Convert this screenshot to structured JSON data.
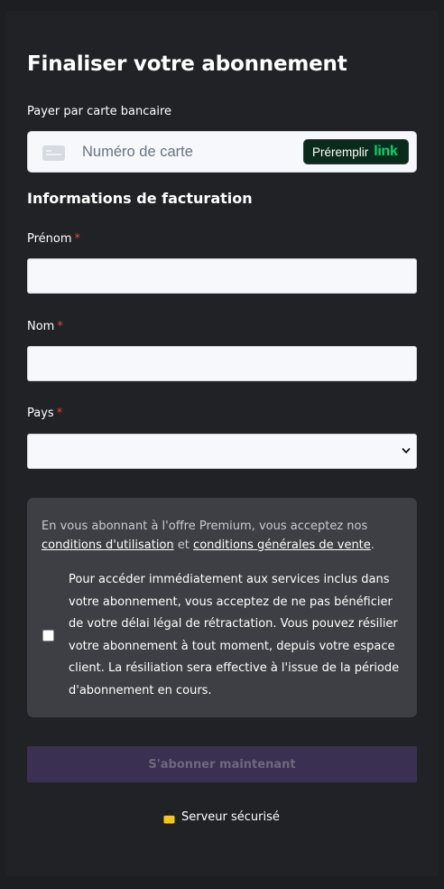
{
  "checkout": {
    "title": "Finaliser votre abonnement",
    "pay_by_card_label": "Payer par carte bancaire",
    "card_number_placeholder": "Numéro de carte",
    "link_button": {
      "label": "Préremplir",
      "brand": "link"
    }
  },
  "billing": {
    "section_title": "Informations de facturation",
    "required_marker": "*",
    "first_name": {
      "label": "Prénom",
      "value": ""
    },
    "last_name": {
      "label": "Nom",
      "value": ""
    },
    "country": {
      "label": "Pays",
      "selected": ""
    }
  },
  "terms": {
    "intro": "En vous abonnant à l'offre Premium, vous acceptez nos",
    "terms_of_use_link": "conditions d'utilisation",
    "conjunction": "et",
    "terms_of_sale_link": "conditions générales de vente",
    "end_punctuation": ".",
    "consent_checked": false,
    "consent_text": "Pour accéder immédiatement aux services inclus dans votre abonnement, vous acceptez de ne pas bénéficier de votre délai légal de rétractation. Vous pouvez résilier votre abonnement à tout moment, depuis votre espace client. La résiliation sera effective à l'issue de la période d'abonnement en cours."
  },
  "actions": {
    "subscribe_label": "S'abonner maintenant",
    "subscribe_enabled": false
  },
  "footer": {
    "secure_label": "Serveur sécurisé",
    "icon": "lock-icon"
  },
  "colors": {
    "background": "#202226",
    "terms_box": "#3e3f44",
    "required": "#e0443c",
    "link_brand": "#00d66f",
    "subscribe_disabled": "#3a3052",
    "lock": "#f5c518"
  }
}
